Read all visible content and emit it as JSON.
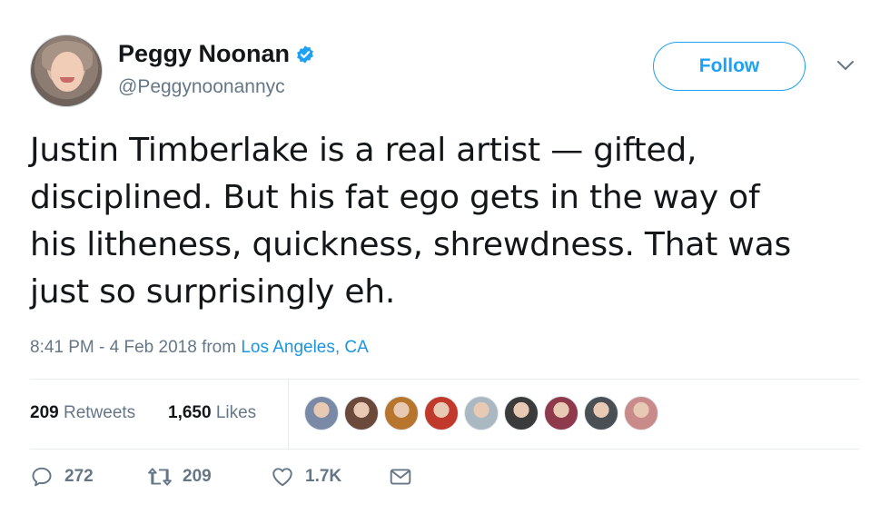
{
  "author": {
    "name": "Peggy Noonan",
    "handle": "@Peggynoonannyc"
  },
  "follow_label": "Follow",
  "tweet": {
    "text": "Justin Timberlake is a real artist — gifted,\ndisciplined. But his fat ego gets in the way of\nhis litheness, quickness, shrewdness. That was\njust so surprisingly eh.",
    "time": "8:41 PM - 4 Feb 2018",
    "from": "from",
    "location": "Los Angeles, CA"
  },
  "stats": {
    "retweets_count": "209",
    "retweets_label": "Retweets",
    "likes_count": "1,650",
    "likes_label": "Likes"
  },
  "liker_avatar_colors": [
    "#7a8aa6",
    "#6b4a3c",
    "#b8752e",
    "#c0392b",
    "#aab8c2",
    "#3b3b3b",
    "#8e3a4c",
    "#4a4f56",
    "#c98a8a"
  ],
  "actions": {
    "replies": "272",
    "retweets": "209",
    "likes": "1.7K"
  },
  "colors": {
    "accent": "#1da1f2",
    "link": "#1b95e0",
    "muted": "#657786"
  }
}
